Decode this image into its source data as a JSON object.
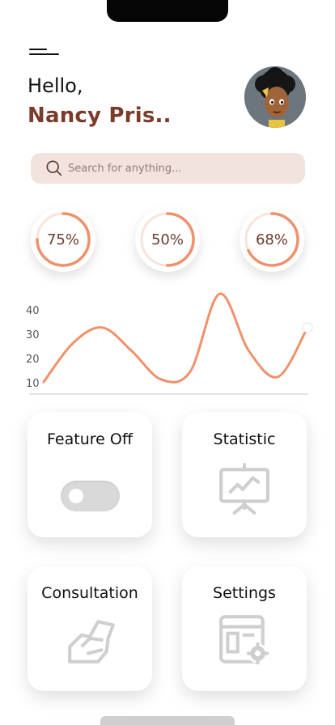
{
  "header": {
    "greeting": "Hello,",
    "user_name": "Nancy Pris.."
  },
  "search": {
    "placeholder": "Search for anything..."
  },
  "progress": [
    {
      "label": "75%",
      "value": 75
    },
    {
      "label": "50%",
      "value": 50
    },
    {
      "label": "68%",
      "value": 68
    }
  ],
  "chart_data": {
    "type": "line",
    "x": [
      0,
      1,
      2,
      3,
      4,
      5,
      6,
      7,
      8
    ],
    "series": [
      {
        "values": [
          10,
          25,
          31,
          22,
          11,
          14,
          44,
          22,
          12,
          31
        ]
      }
    ],
    "ticks": [
      "40",
      "30",
      "20",
      "10"
    ],
    "ylim": [
      10,
      40
    ],
    "grid": false,
    "color": "#f0916a"
  },
  "cards": {
    "feature": {
      "title": "Feature Off",
      "toggle_on": false
    },
    "statistic": {
      "title": "Statistic",
      "icon": "presentation-chart-icon"
    },
    "consultation": {
      "title": "Consultation",
      "icon": "handshake-icon"
    },
    "settings": {
      "title": "Settings",
      "icon": "settings-window-icon"
    }
  },
  "colors": {
    "accent": "#f0916a",
    "name": "#7a3b2a",
    "search_bg": "#f3e3de",
    "ring_track": "#f7e4dc"
  }
}
